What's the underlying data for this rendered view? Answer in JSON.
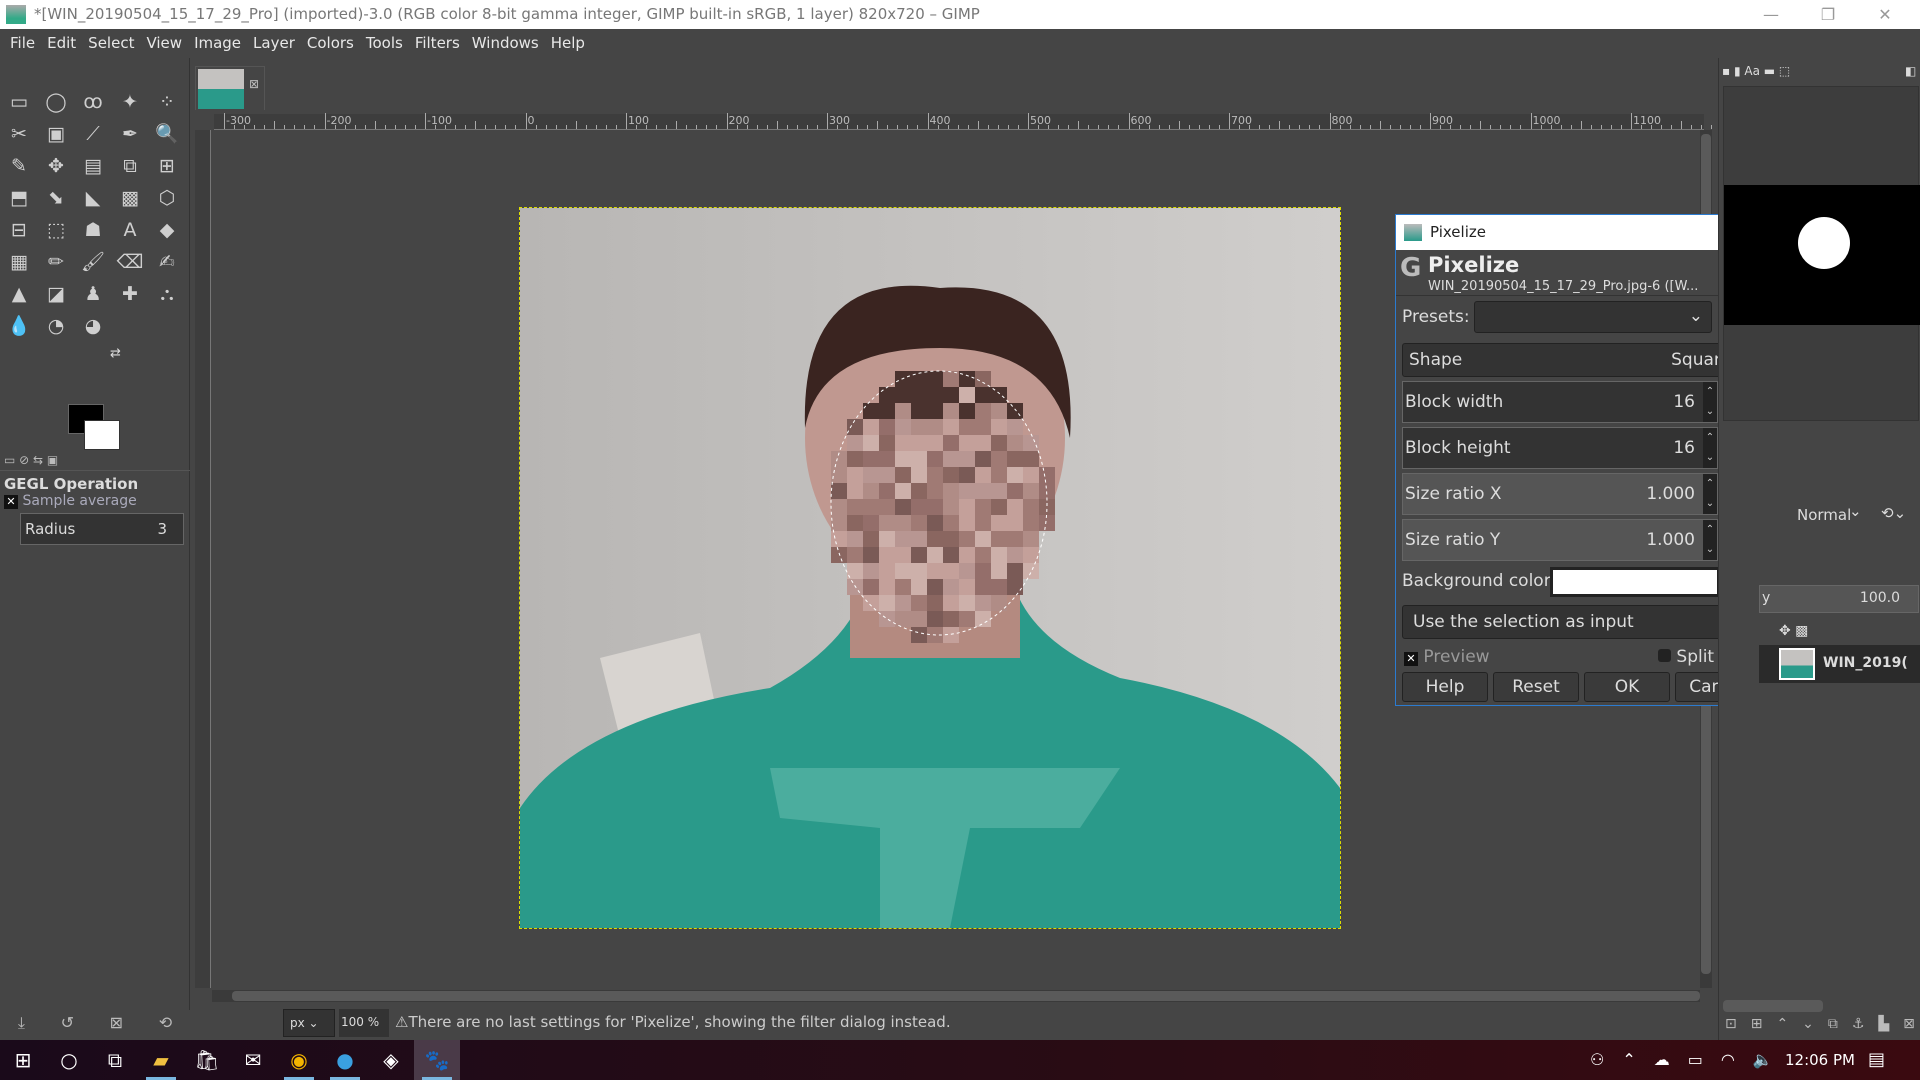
{
  "window": {
    "title": "*[WIN_20190504_15_17_29_Pro] (imported)-3.0 (RGB color 8-bit gamma integer, GIMP built-in sRGB, 1 layer) 820x720 – GIMP"
  },
  "menu": [
    "File",
    "Edit",
    "Select",
    "View",
    "Image",
    "Layer",
    "Colors",
    "Tools",
    "Filters",
    "Windows",
    "Help"
  ],
  "tools": [
    "▭",
    "◯",
    "ꝏ",
    "✦",
    "⁘",
    "✂",
    "▣",
    "⟋",
    "✒",
    "🔍",
    "✎",
    "✥",
    "▤",
    "⧉",
    "⊞",
    "⬒",
    "⬊",
    "◣",
    "▩",
    "⬡",
    "⊟",
    "⬚",
    "☗",
    "A",
    "◆",
    "▦",
    "✏",
    "🖌",
    "⌫",
    "✍",
    "▲",
    "◪",
    "♟",
    "✚",
    "⛬",
    "💧",
    "◔",
    "◕"
  ],
  "tool_options": {
    "title": "GEGL Operation",
    "sample_average": "Sample average",
    "radius_label": "Radius",
    "radius_value": "3"
  },
  "ruler": {
    "labels": [
      "-300",
      "-200",
      "-100",
      "0",
      "100",
      "200",
      "300",
      "400",
      "500",
      "600",
      "700",
      "800",
      "900",
      "1000",
      "1100"
    ]
  },
  "dialog": {
    "window_title": "Pixelize",
    "heading": "Pixelize",
    "subtitle": "WIN_20190504_15_17_29_Pro.jpg-6 ([W...",
    "presets_label": "Presets:",
    "presets_value": "",
    "shape_label": "Shape",
    "shape_value": "Square",
    "block_width_label": "Block width",
    "block_width": "16",
    "block_height_label": "Block height",
    "block_height": "16",
    "size_ratio_x_label": "Size ratio X",
    "size_ratio_x": "1.000",
    "size_ratio_y_label": "Size ratio Y",
    "size_ratio_y": "1.000",
    "background_color_label": "Background color",
    "background_color": "#ffffff",
    "input_mode": "Use the selection as input",
    "preview_label": "Preview",
    "preview_checked": true,
    "split_view_label": "Split view",
    "split_view_checked": false,
    "buttons": {
      "help": "Help",
      "reset": "Reset",
      "ok": "OK",
      "cancel": "Cancel"
    }
  },
  "layers": {
    "mode": "Normal",
    "opacity": "100.0",
    "opacity_label": "y",
    "layer_name": "WIN_2019("
  },
  "status": {
    "unit": "px",
    "zoom": "100 %",
    "message": "There are no last settings for 'Pixelize', showing the filter dialog instead."
  },
  "taskbar": {
    "time": "12:06 PM"
  }
}
